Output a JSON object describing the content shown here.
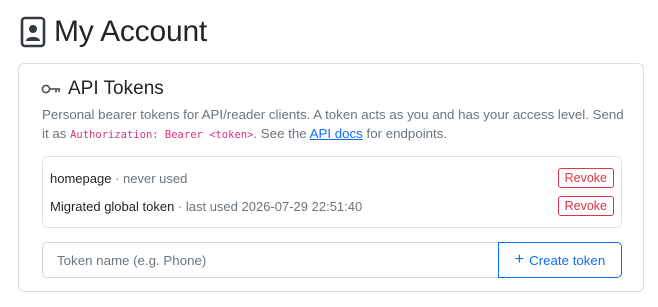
{
  "header": {
    "title": "My Account",
    "icon": "id-badge-icon"
  },
  "api_tokens": {
    "title": "API Tokens",
    "icon": "key-icon",
    "description": {
      "part1": "Personal bearer tokens for API/reader clients. A token acts as you and has your access level. Send it as ",
      "code": "Authorization: Bearer <token>",
      "part2": ". See the ",
      "link_text": "API docs",
      "part3": " for endpoints."
    },
    "tokens": [
      {
        "name": "homepage",
        "meta": " · never used",
        "revoke_label": "Revoke"
      },
      {
        "name": "Migrated global token",
        "meta": " · last used 2026-07-29 22:51:40",
        "revoke_label": "Revoke"
      }
    ],
    "create_form": {
      "placeholder": "Token name (e.g. Phone)",
      "value": "",
      "button_icon": "plus-icon",
      "button_label": "Create token"
    }
  },
  "colors": {
    "primary": "#0d6efd",
    "danger": "#dc3545",
    "code": "#d63384",
    "muted": "#6c757d"
  }
}
